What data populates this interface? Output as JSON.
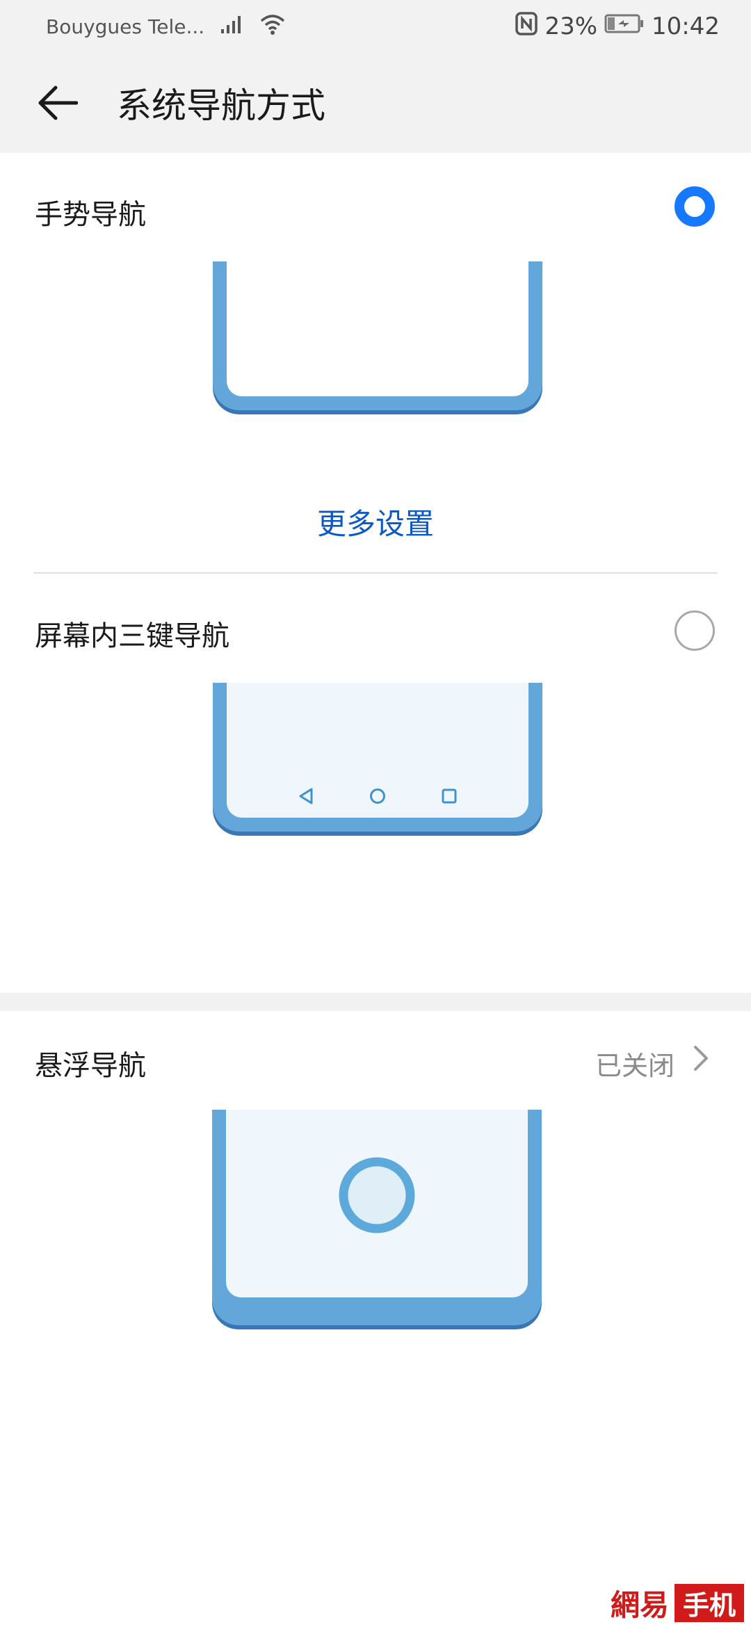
{
  "status_bar": {
    "carrier": "Bouygues Tele...",
    "battery_percent": "23%",
    "time": "10:42",
    "icons": [
      "signal-icon",
      "wifi-icon",
      "nfc-icon",
      "battery-charging-icon"
    ]
  },
  "app_bar": {
    "title": "系统导航方式",
    "back_icon": "back-arrow-icon"
  },
  "options": {
    "gesture": {
      "label": "手势导航",
      "selected": true,
      "more_settings_label": "更多设置"
    },
    "three_key": {
      "label": "屏幕内三键导航",
      "selected": false,
      "nav_icons": [
        "back-triangle-icon",
        "home-circle-icon",
        "recents-square-icon"
      ]
    },
    "floating": {
      "label": "悬浮导航",
      "status": "已关闭",
      "chevron_icon": "chevron-right-icon"
    }
  },
  "colors": {
    "accent": "#1677ff",
    "link": "#0a59c4",
    "phone_frame": "#63a7da",
    "phone_screen": "#f0f7fc",
    "watermark_red": "#d11a1a"
  },
  "watermark": {
    "left": "網易",
    "right": "手机"
  }
}
